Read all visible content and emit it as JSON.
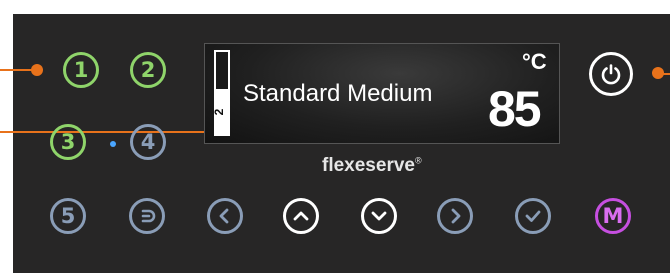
{
  "display": {
    "mode": "Standard Medium",
    "unit": "°C",
    "temperature": "85",
    "level_number": "2",
    "level_fraction": 0.55
  },
  "brand": {
    "name": "flexeserve",
    "mark": "®"
  },
  "buttons": {
    "preset_1": "1",
    "preset_2": "2",
    "preset_3": "3",
    "preset_4": "4",
    "preset_5": "5",
    "menu": "M"
  },
  "icons": {
    "power": "power-icon",
    "back": "back-arrow-icon",
    "left": "chevron-left-icon",
    "up": "chevron-up-icon",
    "down": "chevron-down-icon",
    "right": "chevron-right-icon",
    "confirm": "checkmark-icon"
  },
  "colors": {
    "panel": "#272626",
    "callout": "#e8721b",
    "active_green": "#8fd46a",
    "inactive_blue": "#8a9db7",
    "menu_magenta": "#c64fe0",
    "indicator_blue": "#4aa6ff"
  }
}
